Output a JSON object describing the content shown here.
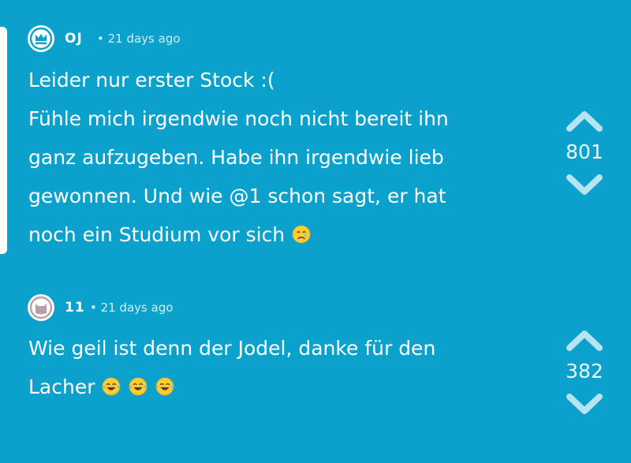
{
  "colors": {
    "background": "#0AA1CD",
    "foreground": "#FFFFFF",
    "vote_arrow": "#B6E4F3"
  },
  "posts": [
    {
      "author": "OJ",
      "avatar_icon": "crown-icon",
      "time": "• 21 days ago",
      "lines": [
        "Leider nur erster Stock :(",
        "Fühle mich irgendwie noch nicht bereit ihn",
        "ganz aufzugeben. Habe ihn irgendwie lieb",
        "gewonnen. Und wie @1 schon sagt, er hat",
        "noch ein Studium vor sich"
      ],
      "trailing_emoji": "crying-face-emoji",
      "votes": "801",
      "is_op": true
    },
    {
      "author": "11",
      "avatar_icon": "cat-icon",
      "time": "• 21 days ago",
      "lines": [
        "Wie geil ist denn der Jodel, danke für den",
        "Lacher"
      ],
      "trailing_emoji": "tears-of-joy-emoji",
      "votes": "382",
      "is_op": false
    }
  ]
}
